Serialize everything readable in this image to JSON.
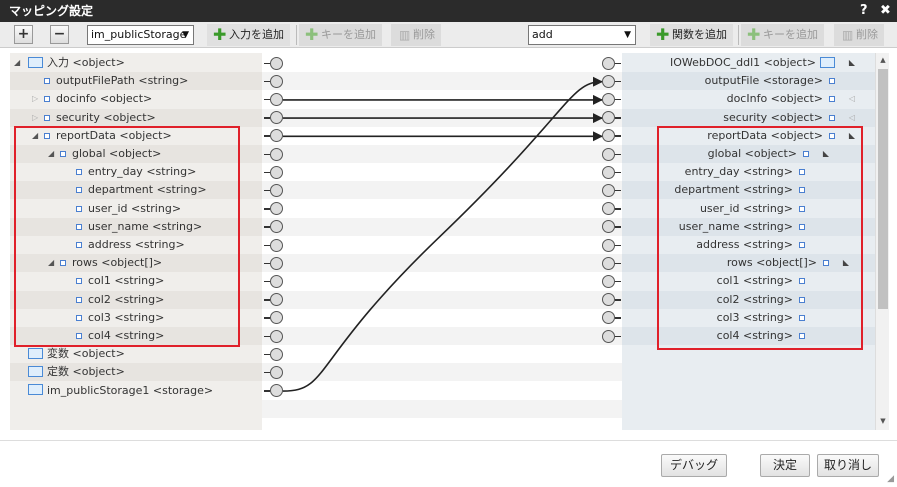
{
  "window": {
    "title": "マッピング設定",
    "help_icon": "?",
    "close_icon": "✖"
  },
  "toolbar": {
    "expand_all": "+",
    "collapse_all": "−",
    "input_select_value": "im_publicStorage",
    "add_input_label": "入力を追加",
    "add_key_label": "キーを追加",
    "delete_label": "削除",
    "function_select_value": "add",
    "add_function_label": "関数を追加",
    "add_key_label_right": "キーを追加",
    "delete_label_right": "削除"
  },
  "left_tree": [
    {
      "label": "入力 <object>",
      "icon": "folder-icon",
      "expander": "expanded"
    },
    {
      "label": "outputFilePath <string>",
      "icon": "field-icon",
      "expander": "none"
    },
    {
      "label": "docinfo <object>",
      "icon": "field-icon",
      "expander": "collapsed"
    },
    {
      "label": "security <object>",
      "icon": "field-icon",
      "expander": "collapsed"
    },
    {
      "label": "reportData <object>",
      "icon": "field-icon",
      "expander": "expanded"
    },
    {
      "label": "global <object>",
      "icon": "field-icon",
      "expander": "expanded"
    },
    {
      "label": "entry_day <string>",
      "icon": "field-icon",
      "expander": "none"
    },
    {
      "label": "department <string>",
      "icon": "field-icon",
      "expander": "none"
    },
    {
      "label": "user_id <string>",
      "icon": "field-icon",
      "expander": "none"
    },
    {
      "label": "user_name <string>",
      "icon": "field-icon",
      "expander": "none"
    },
    {
      "label": "address <string>",
      "icon": "field-icon",
      "expander": "none"
    },
    {
      "label": "rows <object[]>",
      "icon": "field-icon",
      "expander": "expanded"
    },
    {
      "label": "col1 <string>",
      "icon": "field-icon",
      "expander": "none"
    },
    {
      "label": "col2 <string>",
      "icon": "field-icon",
      "expander": "none"
    },
    {
      "label": "col3 <string>",
      "icon": "field-icon",
      "expander": "none"
    },
    {
      "label": "col4 <string>",
      "icon": "field-icon",
      "expander": "none"
    },
    {
      "label": "変数 <object>",
      "icon": "folder-icon",
      "expander": "none"
    },
    {
      "label": "定数 <object>",
      "icon": "folder-icon",
      "expander": "none"
    },
    {
      "label": "im_publicStorage1 <storage>",
      "icon": "folder-icon",
      "expander": "none"
    }
  ],
  "right_tree": [
    {
      "label": "IOWebDOC_ddl1 <object>",
      "icon": "folder-icon",
      "expander": "expanded"
    },
    {
      "label": "outputFile <storage>",
      "icon": "field-icon",
      "expander": "none"
    },
    {
      "label": "docInfo <object>",
      "icon": "field-icon",
      "expander": "collapsed"
    },
    {
      "label": "security <object>",
      "icon": "field-icon",
      "expander": "collapsed"
    },
    {
      "label": "reportData <object>",
      "icon": "field-icon",
      "expander": "expanded"
    },
    {
      "label": "global <object>",
      "icon": "field-icon",
      "expander": "expanded"
    },
    {
      "label": "entry_day <string>",
      "icon": "field-icon",
      "expander": "none"
    },
    {
      "label": "department <string>",
      "icon": "field-icon",
      "expander": "none"
    },
    {
      "label": "user_id <string>",
      "icon": "field-icon",
      "expander": "none"
    },
    {
      "label": "user_name <string>",
      "icon": "field-icon",
      "expander": "none"
    },
    {
      "label": "address <string>",
      "icon": "field-icon",
      "expander": "none"
    },
    {
      "label": "rows <object[]>",
      "icon": "field-icon",
      "expander": "expanded"
    },
    {
      "label": "col1 <string>",
      "icon": "field-icon",
      "expander": "none"
    },
    {
      "label": "col2 <string>",
      "icon": "field-icon",
      "expander": "none"
    },
    {
      "label": "col3 <string>",
      "icon": "field-icon",
      "expander": "none"
    },
    {
      "label": "col4 <string>",
      "icon": "field-icon",
      "expander": "none"
    }
  ],
  "mappings": [
    {
      "from": "im_publicStorage1 <storage>",
      "to": "outputFile <storage>"
    },
    {
      "from": "docinfo <object>",
      "to": "docInfo <object>"
    },
    {
      "from": "security <object>",
      "to": "security <object>"
    },
    {
      "from": "reportData <object>",
      "to": "reportData <object>"
    }
  ],
  "footer": {
    "debug_label": "デバッグ",
    "ok_label": "決定",
    "cancel_label": "取り消し"
  },
  "colors": {
    "highlight_box": "#e0202a",
    "title_bar": "#2b2b2b",
    "add_icon": "#3a9a2a"
  }
}
